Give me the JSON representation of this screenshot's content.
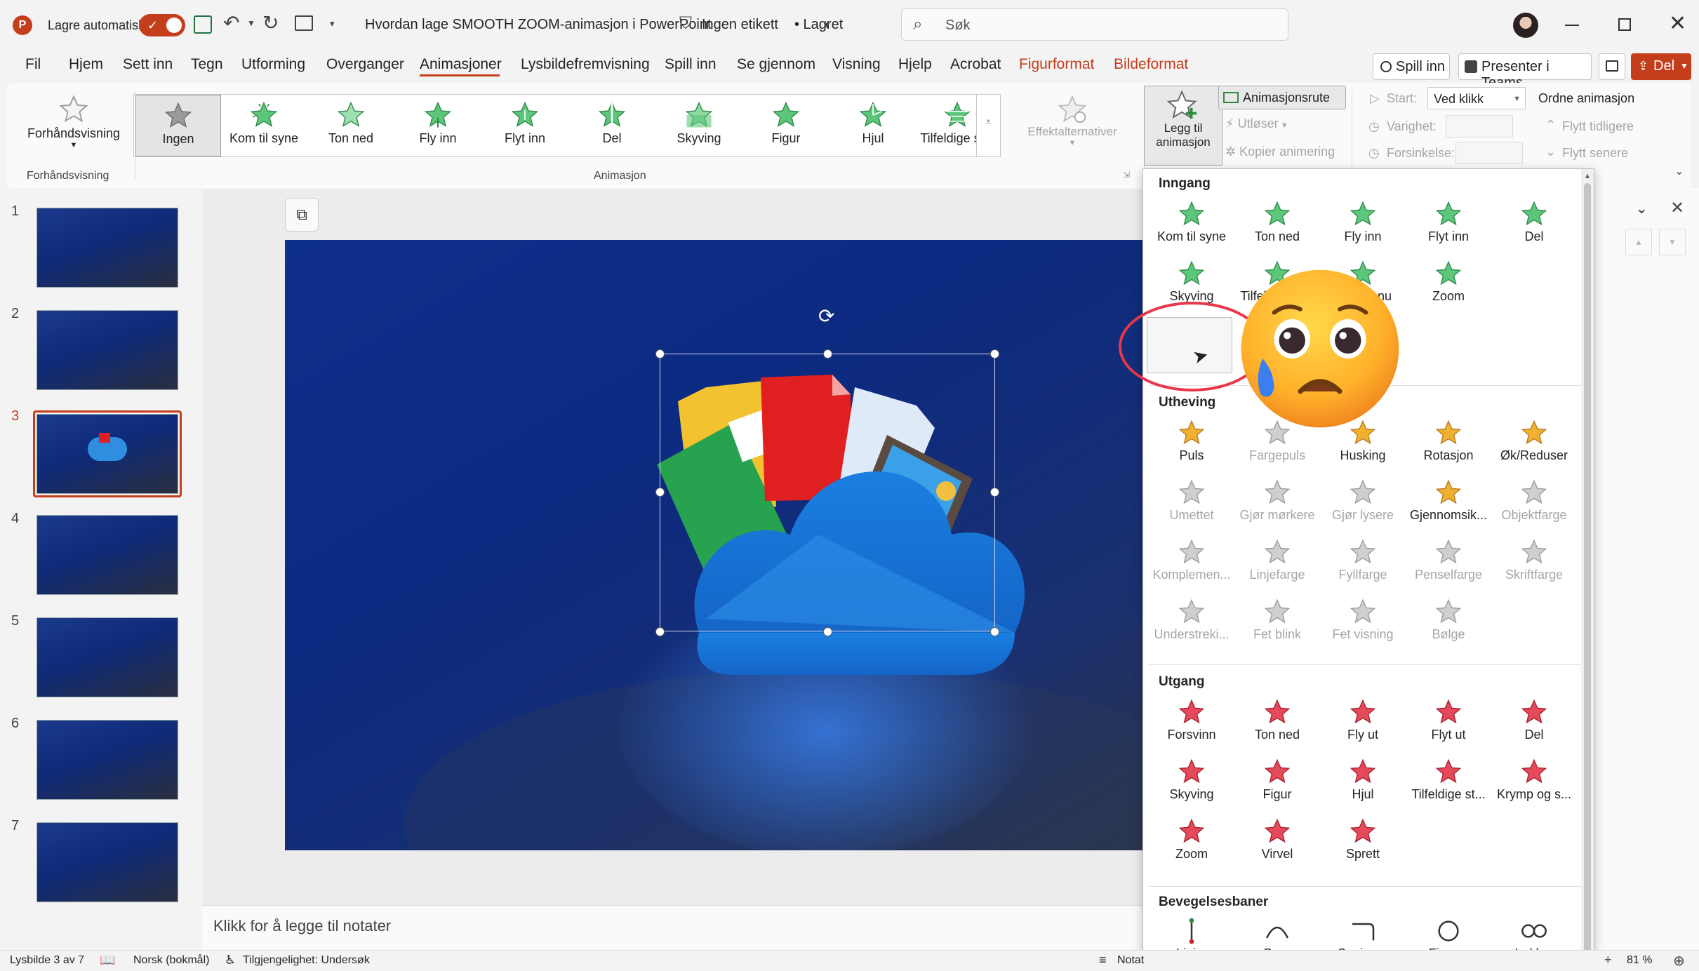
{
  "titlebar": {
    "autosave_label": "Lagre automatisk",
    "document_title": "Hvordan lage SMOOTH ZOOM-animasjon i PowerPoint",
    "label": "Ingen etikett",
    "saved": "• Lagret",
    "search_placeholder": "Søk"
  },
  "tabs": [
    "Fil",
    "Hjem",
    "Sett inn",
    "Tegn",
    "Utforming",
    "Overganger",
    "Animasjoner",
    "Lysbildefremvisning",
    "Spill inn",
    "Se gjennom",
    "Visning",
    "Hjelp",
    "Acrobat",
    "Figurformat",
    "Bildeformat"
  ],
  "actions": {
    "record": "Spill inn",
    "teams": "Presenter i Teams",
    "share": "Del"
  },
  "ribbon": {
    "preview_label": "Forhåndsvisning",
    "preview_group": "Forhåndsvisning",
    "animation_group": "Animasjon",
    "gallery": [
      "Ingen",
      "Kom til syne",
      "Ton ned",
      "Fly inn",
      "Flyt inn",
      "Del",
      "Skyving",
      "Figur",
      "Hjul",
      "Tilfeldige st..."
    ],
    "effect_options": "Effektalternativer",
    "add_animation_1": "Legg til",
    "add_animation_2": "animasjon",
    "animation_pane": "Animasjonsrute",
    "trigger": "Utløser",
    "copy_animation": "Kopier animering",
    "start_label": "Start:",
    "start_value": "Ved klikk",
    "duration_label": "Varighet:",
    "delay_label": "Forsinkelse:",
    "reorder_title": "Ordne animasjon",
    "move_earlier": "Flytt tidligere",
    "move_later": "Flytt senere"
  },
  "slides": [
    "1",
    "2",
    "3",
    "4",
    "5",
    "6",
    "7"
  ],
  "notes_placeholder": "Klikk for å legge til notater",
  "status": {
    "slide_info": "Lysbilde 3 av 7",
    "language": "Norsk (bokmål)",
    "accessibility": "Tilgjengelighet: Undersøk",
    "notes": "Notat",
    "zoom": "81 %"
  },
  "panel": {
    "entrance_title": "Inngang",
    "entrance": [
      "Kom til syne",
      "Ton ned",
      "Fly inn",
      "Flyt inn",
      "Del",
      "Skyving",
      "Tilfeldige st...",
      "Øk og snu",
      "Zoom"
    ],
    "emphasis_title": "Utheving",
    "emphasis": [
      "Puls",
      "Fargepuls",
      "Husking",
      "Rotasjon",
      "Øk/Reduser",
      "Umettet",
      "Gjør mørkere",
      "Gjør lysere",
      "Gjennomsik...",
      "Objektfarge",
      "Komplemen...",
      "Linjefarge",
      "Fyllfarge",
      "Penselfarge",
      "Skriftfarge",
      "Understreki...",
      "Fet blink",
      "Fet visning",
      "Bølge"
    ],
    "exit_title": "Utgang",
    "exit": [
      "Forsvinn",
      "Ton ned",
      "Fly ut",
      "Flyt ut",
      "Del",
      "Skyving",
      "Figur",
      "Hjul",
      "Tilfeldige st...",
      "Krymp og s...",
      "Zoom",
      "Virvel",
      "Sprett"
    ],
    "motion_title": "Bevegelsesbaner",
    "motion": [
      "Linjer",
      "Buer",
      "Snuinger",
      "Figurer",
      "Løkker"
    ]
  },
  "colors": {
    "accent": "#c43e1c",
    "entrance_star": "#5cc77a",
    "emphasis_star": "#f0b030",
    "exit_star": "#e44a5a",
    "slide_bg": "#0f2f8c",
    "highlight_circle": "#e8364a"
  }
}
